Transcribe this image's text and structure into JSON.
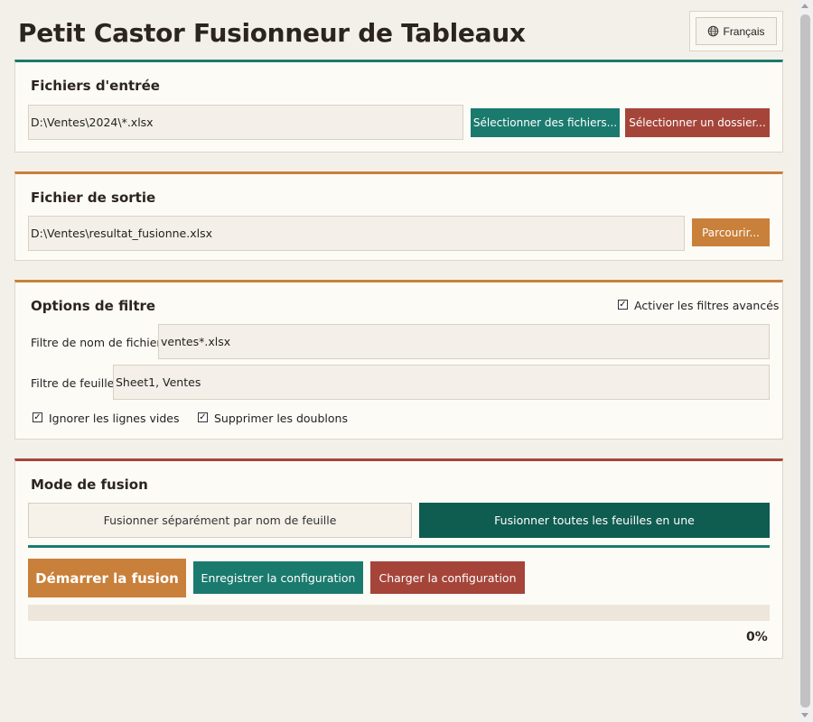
{
  "app": {
    "title": "Petit Castor Fusionneur de Tableaux"
  },
  "language": {
    "label": "Français",
    "icon": "globe-icon"
  },
  "input_section": {
    "title": "Fichiers d'entrée",
    "path_value": "D:\\Ventes\\2024\\*.xlsx",
    "select_files_label": "Sélectionner des fichiers...",
    "select_folder_label": "Sélectionner un dossier..."
  },
  "output_section": {
    "title": "Fichier de sortie",
    "path_value": "D:\\Ventes\\resultat_fusionne.xlsx",
    "browse_label": "Parcourir..."
  },
  "filter_section": {
    "title": "Options de filtre",
    "advanced_label": "Activer les filtres avancés",
    "advanced_checked": true,
    "filename_label": "Filtre de nom de fichier:",
    "filename_value": "ventes*.xlsx",
    "sheet_label": "Filtre de feuille:",
    "sheet_value": "Sheet1, Ventes",
    "ignore_empty_label": "Ignorer les lignes vides",
    "ignore_empty_checked": true,
    "remove_duplicates_label": "Supprimer les doublons",
    "remove_duplicates_checked": true
  },
  "merge_section": {
    "title": "Mode de fusion",
    "mode_separate_label": "Fusionner séparément par nom de feuille",
    "mode_all_label": "Fusionner toutes les feuilles en une",
    "selected_mode": "all",
    "start_label": "Démarrer la fusion",
    "save_config_label": "Enregistrer la configuration",
    "load_config_label": "Charger la configuration",
    "progress_text": "0%",
    "progress_value": 0
  },
  "colors": {
    "teal": "#1b7a6e",
    "dark_teal": "#0f5c50",
    "orange": "#c9803a",
    "red": "#a5453a",
    "background": "#f3f0ea"
  }
}
